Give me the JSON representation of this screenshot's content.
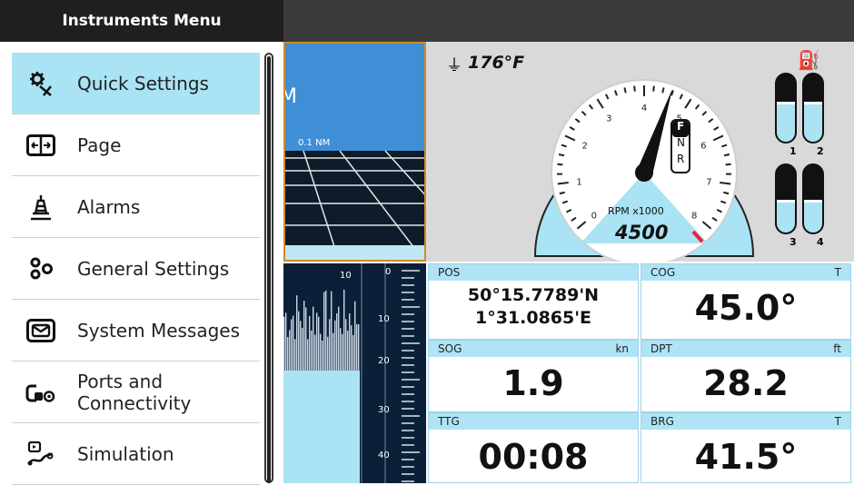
{
  "menu": {
    "title": "Instruments Menu",
    "items": [
      {
        "label": "Quick Settings",
        "icon": "quick-settings-icon",
        "selected": true
      },
      {
        "label": "Page",
        "icon": "page-icon"
      },
      {
        "label": "Alarms",
        "icon": "alarms-icon"
      },
      {
        "label": "General Settings",
        "icon": "general-settings-icon"
      },
      {
        "label": "System Messages",
        "icon": "system-messages-icon"
      },
      {
        "label": "Ports and",
        "label2": "Connectivity",
        "icon": "ports-connectivity-icon"
      },
      {
        "label": "Simulation",
        "icon": "simulation-icon"
      }
    ]
  },
  "chart": {
    "scale_label": "0.1 NM",
    "edge_letter": "M"
  },
  "sonar": {
    "depth_ticks": [
      "0",
      "10",
      "20",
      "30",
      "40"
    ],
    "range_label": "10"
  },
  "engine": {
    "temperature": "176°F",
    "rpm_label": "RPM x1000",
    "rpm_value": "4500",
    "gear": [
      "F",
      "N",
      "R"
    ],
    "gear_selected": "F",
    "dial_numbers": [
      "0",
      "1",
      "2",
      "3",
      "4",
      "5",
      "6",
      "7",
      "8"
    ],
    "tanks": [
      {
        "label": "1",
        "level": 0.55
      },
      {
        "label": "2",
        "level": 0.55
      },
      {
        "label": "3",
        "level": 0.45
      },
      {
        "label": "4",
        "level": 0.45
      }
    ]
  },
  "data": {
    "pos": {
      "label": "POS",
      "lat": "50°15.7789'N",
      "lon": "1°31.0865'E"
    },
    "cog": {
      "label": "COG",
      "unit": "T",
      "value": "45.0°"
    },
    "sog": {
      "label": "SOG",
      "unit": "kn",
      "value": "1.9"
    },
    "dpt": {
      "label": "DPT",
      "unit": "ft",
      "value": "28.2"
    },
    "ttg": {
      "label": "TTG",
      "value": "00:08"
    },
    "brg": {
      "label": "BRG",
      "unit": "T",
      "value": "41.5°"
    }
  },
  "colors": {
    "accent": "#a9e3f4",
    "header": "#1f1f1f",
    "chart_water": "#3f8fd6",
    "gauge_blue": "#a9e3f4"
  }
}
